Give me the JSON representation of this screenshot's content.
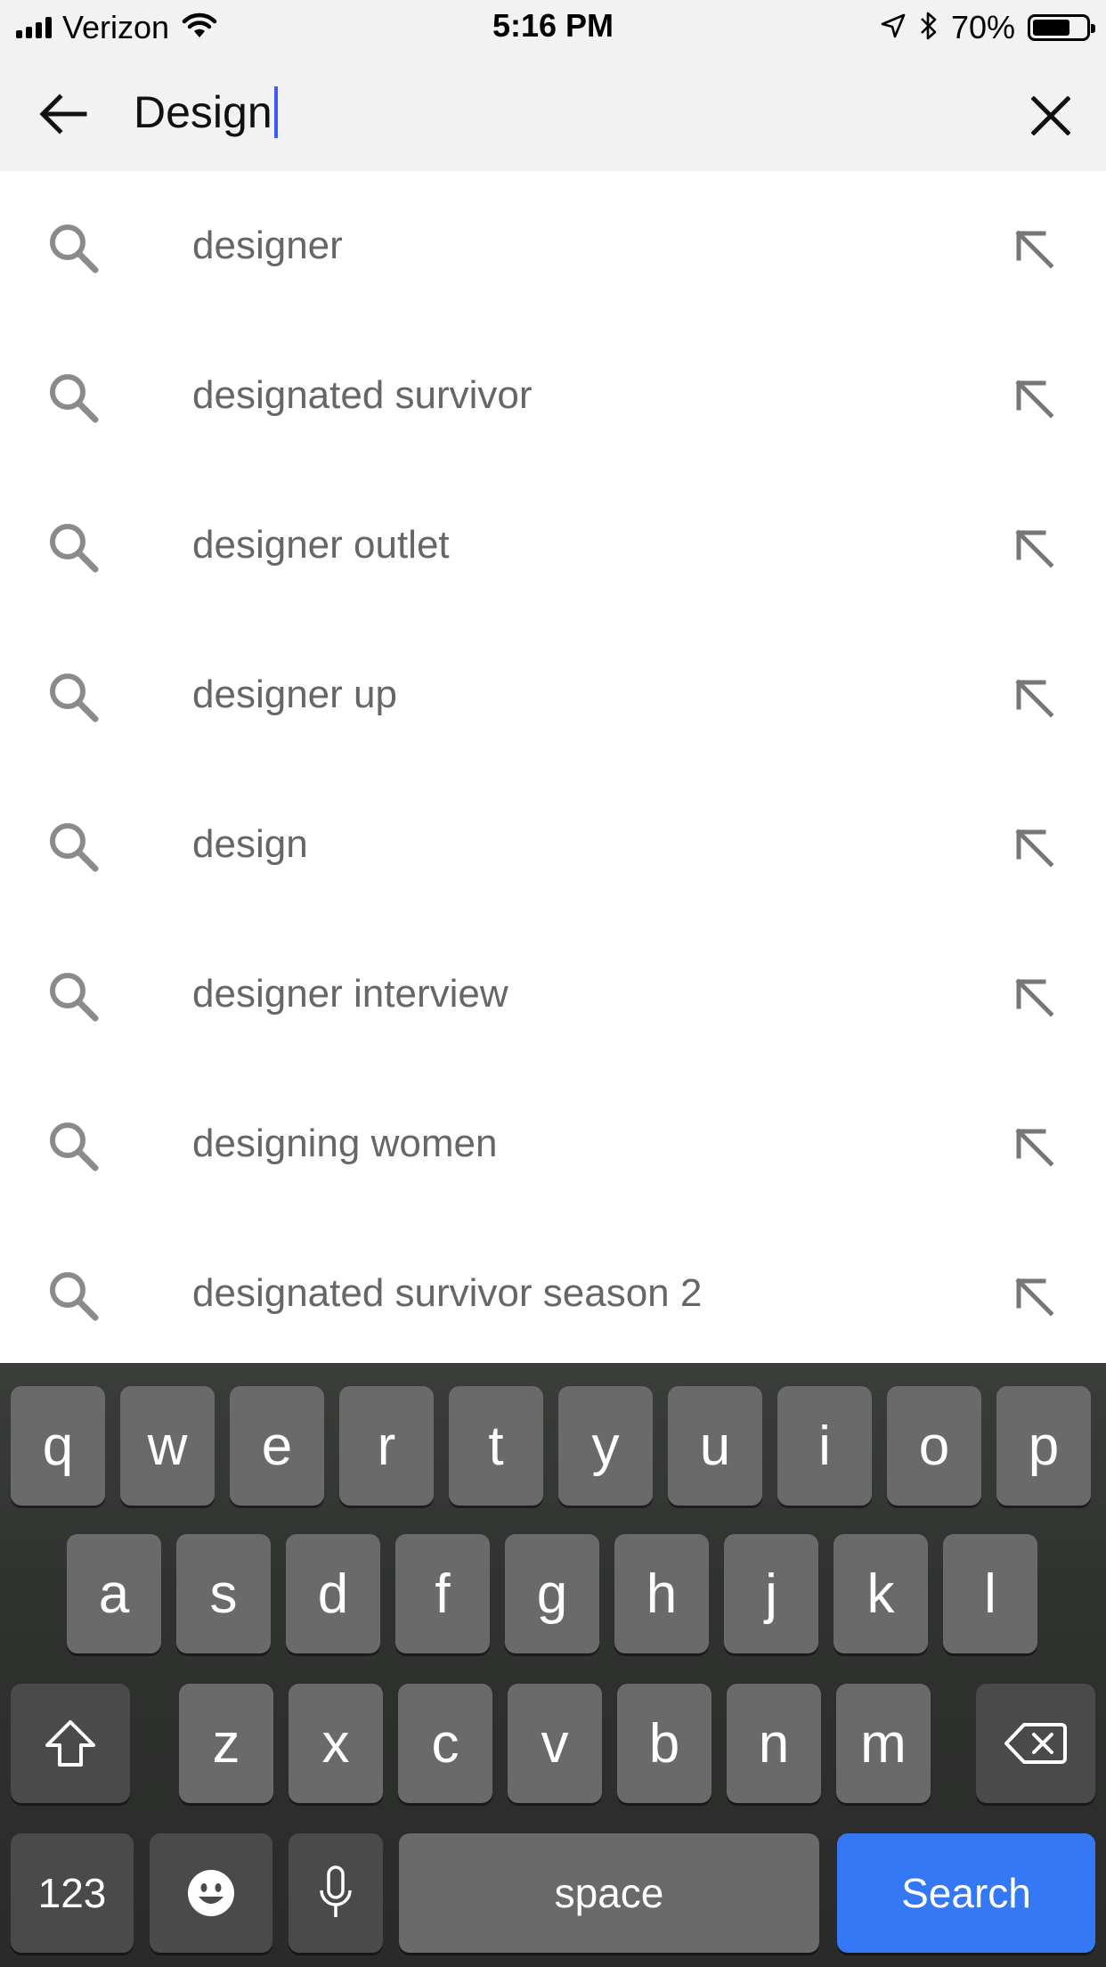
{
  "status_bar": {
    "carrier": "Verizon",
    "time": "5:16 PM",
    "battery_percent": "70%",
    "battery_level": 0.7
  },
  "search": {
    "query": "Design"
  },
  "suggestions": [
    "designer",
    "designated survivor",
    "designer outlet",
    "designer up",
    "design",
    "designer interview",
    "designing women",
    "designated survivor season 2"
  ],
  "keyboard": {
    "row1": [
      "q",
      "w",
      "e",
      "r",
      "t",
      "y",
      "u",
      "i",
      "o",
      "p"
    ],
    "row2": [
      "a",
      "s",
      "d",
      "f",
      "g",
      "h",
      "j",
      "k",
      "l"
    ],
    "row3": [
      "z",
      "x",
      "c",
      "v",
      "b",
      "n",
      "m"
    ],
    "numbers_label": "123",
    "space_label": "space",
    "search_label": "Search",
    "search_color": "#3478f6"
  },
  "icons": {
    "back": "arrow-left-icon",
    "clear": "close-icon",
    "suggestion": "search-icon",
    "fill": "arrow-up-left-icon",
    "shift": "shift-icon",
    "delete": "backspace-icon",
    "emoji": "emoji-icon",
    "mic": "microphone-icon"
  }
}
